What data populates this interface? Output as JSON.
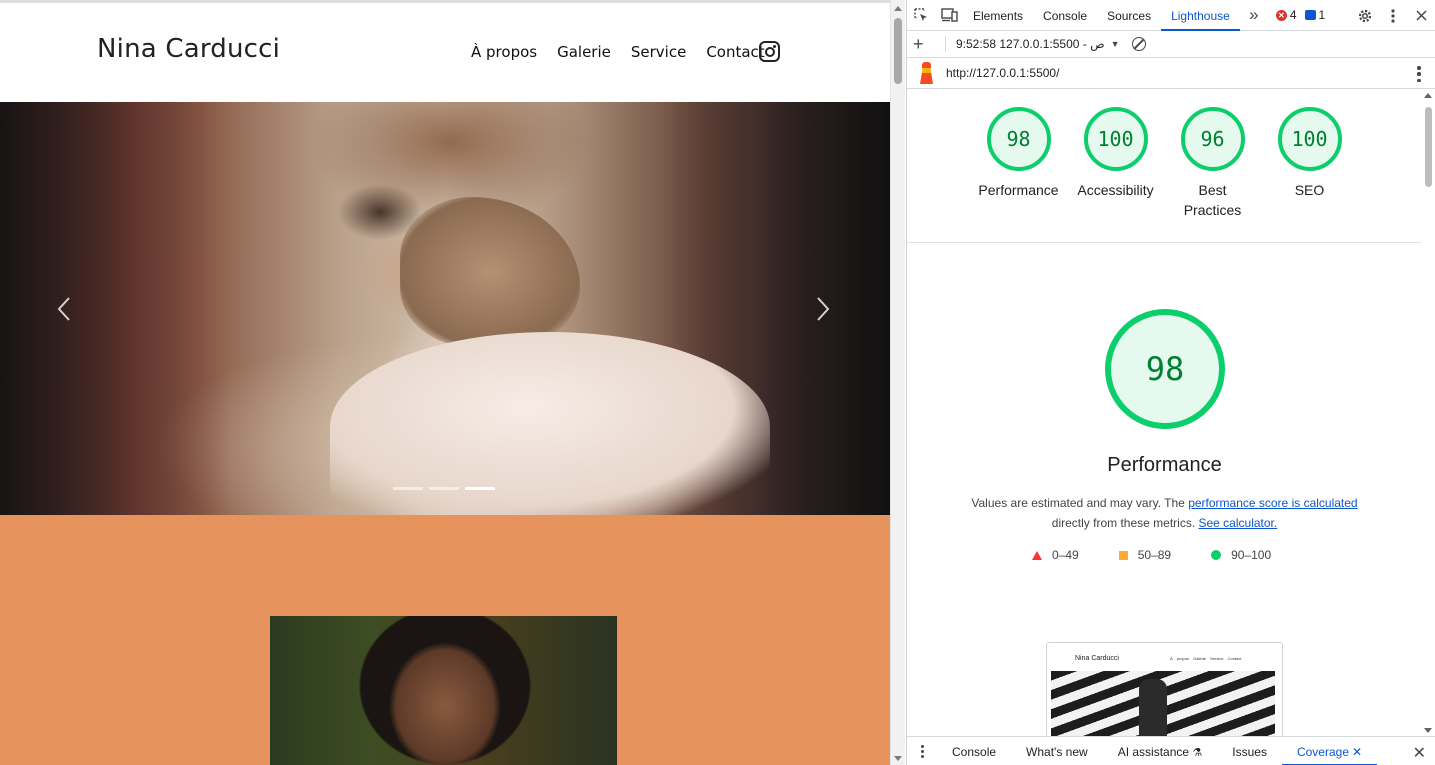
{
  "site": {
    "brand": "Nina Carducci",
    "nav": [
      "À propos",
      "Galerie",
      "Service",
      "Contact"
    ],
    "hero_slides_active_index": 2
  },
  "devtools": {
    "tabs": [
      "Elements",
      "Console",
      "Sources",
      "Lighthouse"
    ],
    "active_tab": "Lighthouse",
    "more_tabs": "»",
    "errors_count": "4",
    "messages_count": "1",
    "toolbar": {
      "run_label": "9:52:58 127.0.0.1:5500 - ص"
    },
    "url": "http://127.0.0.1:5500/",
    "scores": [
      {
        "label": "Performance",
        "value": "98"
      },
      {
        "label": "Accessibility",
        "value": "100"
      },
      {
        "label": "Best Practices",
        "value": "96"
      },
      {
        "label": "SEO",
        "value": "100"
      }
    ],
    "main_score": "98",
    "main_title": "Performance",
    "description": {
      "text1": "Values are estimated and may vary. The",
      "link1": "performance score is calculated",
      "text2": "directly from these metrics.",
      "link2": "See calculator."
    },
    "legend": [
      "0–49",
      "50–89",
      "90–100"
    ],
    "legend_colors": {
      "fail": "#ff3333",
      "average": "#ffaa33",
      "pass": "#0cce6b"
    },
    "thumbnail": {
      "brand": "Nina Carducci",
      "nav": "À propos Galerie Service Contact"
    },
    "drawer_tabs": [
      "Console",
      "What's new",
      "AI assistance",
      "Issues",
      "Coverage"
    ],
    "drawer_active": "Coverage"
  }
}
